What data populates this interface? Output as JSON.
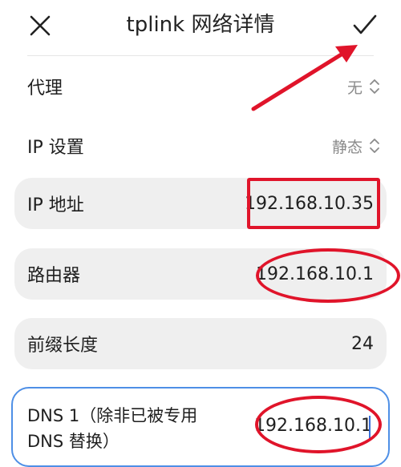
{
  "header": {
    "title": "tplink 网络详情",
    "close_icon": "close-icon",
    "confirm_icon": "checkmark-icon"
  },
  "rows": {
    "proxy": {
      "label": "代理",
      "value": "无"
    },
    "ip_settings": {
      "label": "IP 设置",
      "value": "静态"
    }
  },
  "fields": {
    "ip_address": {
      "label": "IP 地址",
      "value": "192.168.10.35"
    },
    "router": {
      "label": "路由器",
      "value": "192.168.10.1"
    },
    "prefix_length": {
      "label": "前缀长度",
      "value": "24"
    },
    "dns1": {
      "label": "DNS 1（除非已被专用 DNS 替换）",
      "value": "192.168.10.1"
    }
  },
  "annotations": {
    "color": "#e0142a"
  },
  "colors": {
    "card_bg": "#efefef",
    "focus_border": "#4e8fe6"
  }
}
